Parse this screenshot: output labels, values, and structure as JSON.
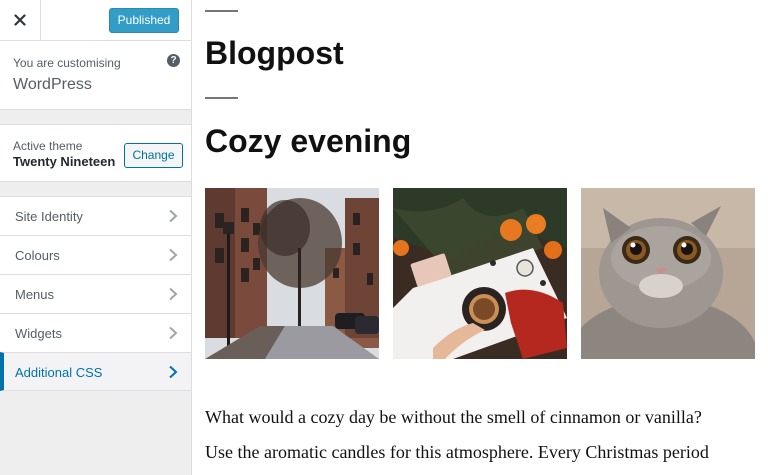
{
  "sidebar": {
    "publish_label": "Published",
    "customising_pre": "You are customising",
    "site_name": "WordPress",
    "active_theme_label": "Active theme",
    "theme_name": "Twenty Nineteen",
    "change_label": "Change",
    "items": [
      {
        "label": "Site Identity"
      },
      {
        "label": "Colours"
      },
      {
        "label": "Menus"
      },
      {
        "label": "Widgets"
      },
      {
        "label": "Additional CSS"
      }
    ],
    "active_item": "Additional CSS"
  },
  "preview": {
    "blog_title": "Blogpost",
    "post_title": "Cozy evening",
    "paragraph_lines": [
      "What would a cozy day be without the smell of cinnamon or vanilla?",
      "Use the aromatic candles for this atmosphere. Every Christmas period"
    ]
  },
  "colors": {
    "accent": "#0073aa",
    "publish_button": "#0085ba",
    "sidebar_bg": "#eeeeee"
  },
  "icons": {
    "close": "close-icon",
    "help": "help-icon",
    "chevron": "chevron-right-icon"
  }
}
